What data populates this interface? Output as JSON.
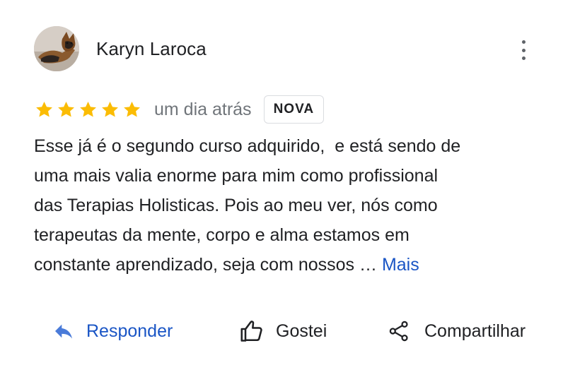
{
  "review": {
    "author_name": "Karyn Laroca",
    "rating": 5,
    "max_rating": 5,
    "time_ago": "um dia atrás",
    "badge": "NOVA",
    "text_lines": [
      "Esse já é o segundo curso adquirido,  e está sendo de",
      "uma mais valia enorme para mim como profissional",
      "das Terapias Holisticas. Pois ao meu ver, nós como",
      "terapeutas da mente, corpo e alma estamos em",
      "constante aprendizado, seja com nossos … "
    ],
    "more_label": "Mais"
  },
  "actions": {
    "reply_label": "Responder",
    "like_label": "Gostei",
    "share_label": "Compartilhar"
  },
  "icons": {
    "menu": "more-vert-icon",
    "reply": "reply-icon",
    "like": "thumb-up-icon",
    "share": "share-icon",
    "star": "star-icon"
  },
  "colors": {
    "star": "#fbbc04",
    "link": "#1a55c5",
    "text": "#202124",
    "secondary_text": "#70757a",
    "icon_gray": "#5f6368",
    "border": "#dadce0"
  }
}
